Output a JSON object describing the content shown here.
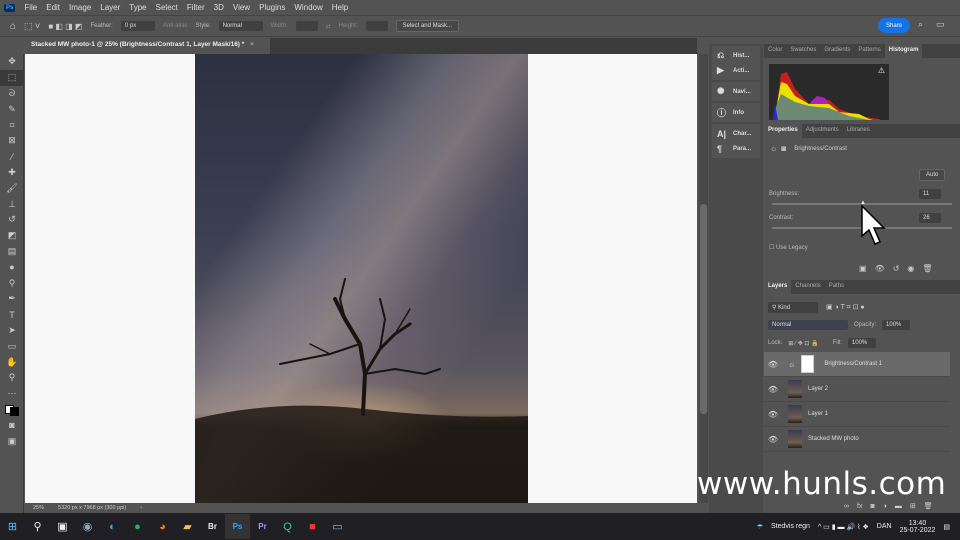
{
  "app": {
    "logo": "Ps",
    "menu": [
      "File",
      "Edit",
      "Image",
      "Layer",
      "Type",
      "Select",
      "Filter",
      "3D",
      "View",
      "Plugins",
      "Window",
      "Help"
    ]
  },
  "options": {
    "feather_label": "Feather:",
    "feather_value": "0 px",
    "antialias": "Anti-alias",
    "style_label": "Style:",
    "style_value": "Normal",
    "width_label": "Width:",
    "height_label": "Height:",
    "select_mask": "Select and Mask...",
    "share": "Share"
  },
  "document": {
    "tab_title": "Stacked MW photo-1 @ 25% (Brightness/Contrast 1, Layer Mask/16) *",
    "close": "×",
    "zoom": "25%",
    "dimensions": "5320 px x 7968 px (300 ppi)",
    "arrow": "›"
  },
  "collapsed_panels": [
    {
      "label": "Hist...",
      "icon": "history-icon"
    },
    {
      "label": "Acti...",
      "icon": "actions-icon"
    },
    {
      "label": "Navi...",
      "icon": "navigator-icon"
    },
    {
      "label": "Info",
      "icon": "info-icon"
    },
    {
      "label": "Char...",
      "icon": "character-icon"
    },
    {
      "label": "Para...",
      "icon": "paragraph-icon"
    }
  ],
  "top_panel": {
    "tabs": [
      "Color",
      "Swatches",
      "Gradients",
      "Patterns",
      "Histogram"
    ],
    "active": "Histogram",
    "warning": "⚠"
  },
  "properties": {
    "tabs": [
      "Properties",
      "Adjustments",
      "Libraries"
    ],
    "title": "Brightness/Contrast",
    "auto": "Auto",
    "brightness_label": "Brightness:",
    "brightness_value": "11",
    "contrast_label": "Contrast:",
    "contrast_value": "26",
    "legacy_label": "Use Legacy",
    "brightness_range": [
      -150,
      150
    ],
    "contrast_range": [
      -50,
      100
    ]
  },
  "layers": {
    "tabs": [
      "Layers",
      "Channels",
      "Paths"
    ],
    "kind": "Kind",
    "blend_mode": "Normal",
    "opacity_label": "Opacity:",
    "opacity_value": "100%",
    "lock_label": "Lock:",
    "fill_label": "Fill:",
    "fill_value": "100%",
    "items": [
      {
        "name": "Brightness/Contrast 1",
        "selected": true
      },
      {
        "name": "Layer 2"
      },
      {
        "name": "Layer 1"
      },
      {
        "name": "Stacked MW photo"
      }
    ]
  },
  "taskbar": {
    "weather": "Stedvis regn",
    "lang": "DAN",
    "time": "13:40",
    "date": "25-07-2022"
  },
  "watermark": "www.hunls.com"
}
